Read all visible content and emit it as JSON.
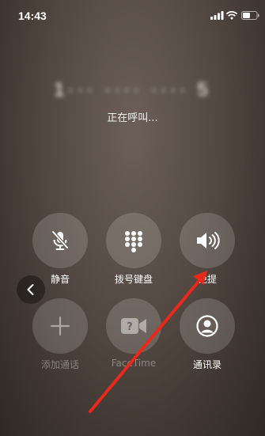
{
  "status": {
    "time": "14:43"
  },
  "call": {
    "number": "1··· ···· ···· 5",
    "status": "正在呼叫..."
  },
  "controls": [
    {
      "key": "mute",
      "label": "静音",
      "icon": "mic-off-icon",
      "enabled": true
    },
    {
      "key": "keypad",
      "label": "拨号键盘",
      "icon": "keypad-icon",
      "enabled": true
    },
    {
      "key": "speaker",
      "label": "免提",
      "icon": "speaker-icon",
      "enabled": true
    },
    {
      "key": "add_call",
      "label": "添加通话",
      "icon": "plus-icon",
      "enabled": false
    },
    {
      "key": "facetime",
      "label": "FaceTime",
      "icon": "video-icon",
      "enabled": false
    },
    {
      "key": "contacts",
      "label": "通讯录",
      "icon": "contact-icon",
      "enabled": true
    }
  ],
  "annotation": {
    "color": "#e8291c"
  }
}
